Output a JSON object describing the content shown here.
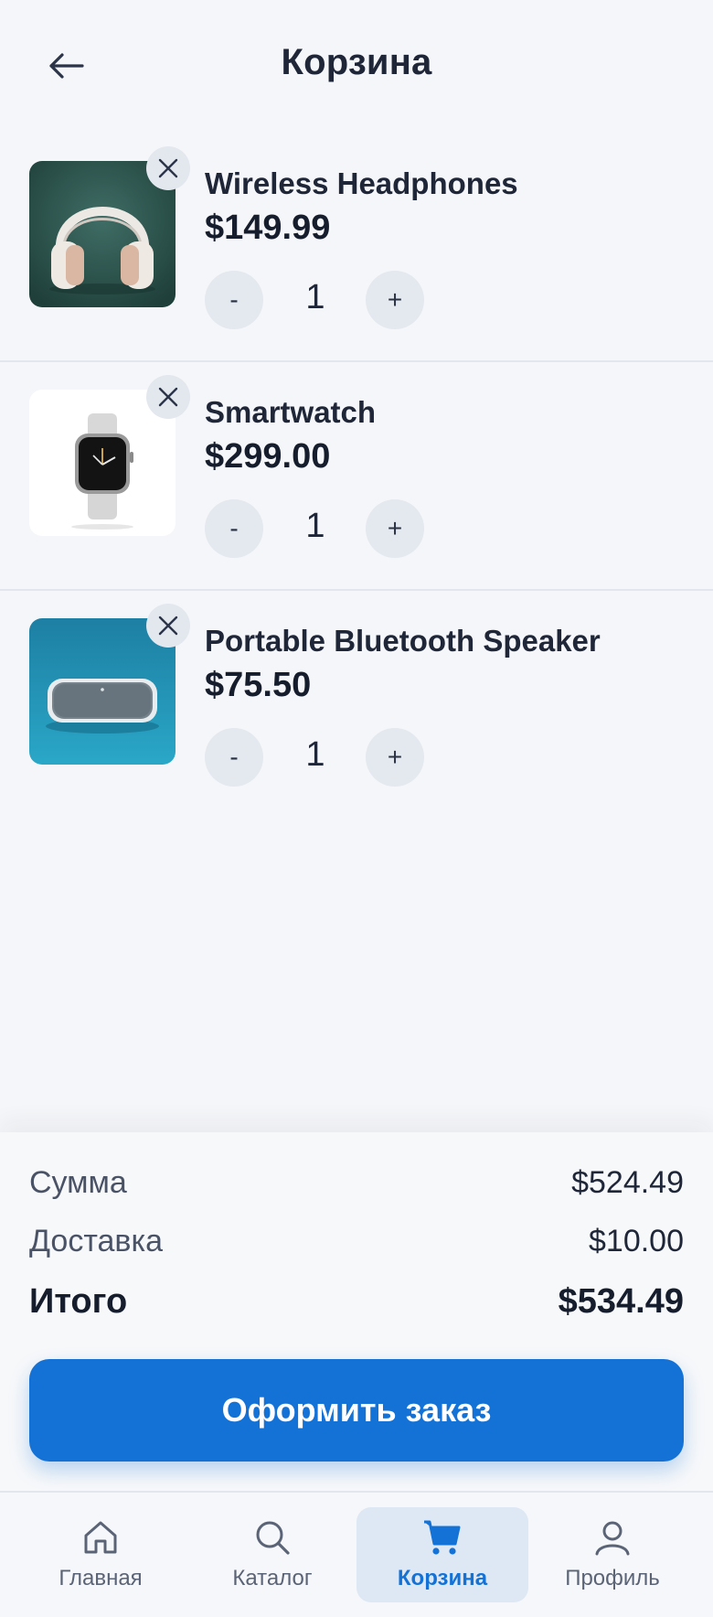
{
  "header": {
    "title": "Корзина",
    "back_icon": "arrow-left-icon"
  },
  "cart": {
    "items": [
      {
        "name": "Wireless Headphones",
        "price": "$149.99",
        "quantity": "1",
        "minus_label": "-",
        "plus_label": "+"
      },
      {
        "name": "Smartwatch",
        "price": "$299.00",
        "quantity": "1",
        "minus_label": "-",
        "plus_label": "+"
      },
      {
        "name": "Portable Bluetooth Speaker",
        "price": "$75.50",
        "quantity": "1",
        "minus_label": "-",
        "plus_label": "+"
      }
    ]
  },
  "summary": {
    "subtotal_label": "Сумма",
    "subtotal_value": "$524.49",
    "delivery_label": "Доставка",
    "delivery_value": "$10.00",
    "total_label": "Итого",
    "total_value": "$534.49",
    "checkout_label": "Оформить заказ"
  },
  "nav": {
    "items": [
      {
        "label": "Главная",
        "icon": "home-icon"
      },
      {
        "label": "Каталог",
        "icon": "search-icon"
      },
      {
        "label": "Корзина",
        "icon": "cart-icon",
        "active": true
      },
      {
        "label": "Профиль",
        "icon": "user-icon"
      }
    ]
  },
  "colors": {
    "accent": "#1472d6",
    "background": "#f5f6f9",
    "text": "#1e2638",
    "muted": "#5b6476"
  }
}
